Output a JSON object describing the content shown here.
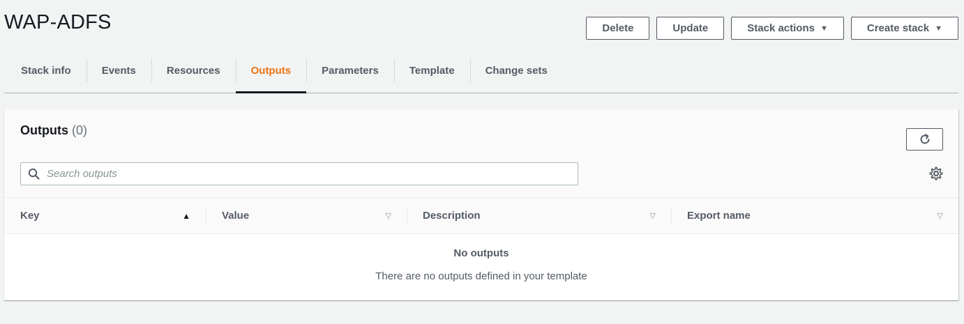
{
  "page": {
    "title": "WAP-ADFS"
  },
  "actions": {
    "delete": "Delete",
    "update": "Update",
    "stack_actions": "Stack actions",
    "create_stack": "Create stack"
  },
  "tabs": [
    {
      "label": "Stack info"
    },
    {
      "label": "Events"
    },
    {
      "label": "Resources"
    },
    {
      "label": "Outputs",
      "active": true
    },
    {
      "label": "Parameters"
    },
    {
      "label": "Template"
    },
    {
      "label": "Change sets"
    }
  ],
  "outputs": {
    "title": "Outputs",
    "count": "(0)",
    "search_placeholder": "Search outputs",
    "columns": [
      {
        "label": "Key",
        "sort": "ascending"
      },
      {
        "label": "Value",
        "sort": "none"
      },
      {
        "label": "Description",
        "sort": "none"
      },
      {
        "label": "Export name",
        "sort": "none"
      }
    ],
    "empty_title": "No outputs",
    "empty_text": "There are no outputs defined in your template"
  },
  "icons": {
    "search": "search-icon",
    "refresh": "refresh-icon",
    "settings": "gear-icon",
    "dropdown": "caret-down-icon"
  },
  "colors": {
    "accent": "#ec7211",
    "text": "#16191f",
    "muted": "#545b64",
    "background": "#f2f3f3"
  }
}
